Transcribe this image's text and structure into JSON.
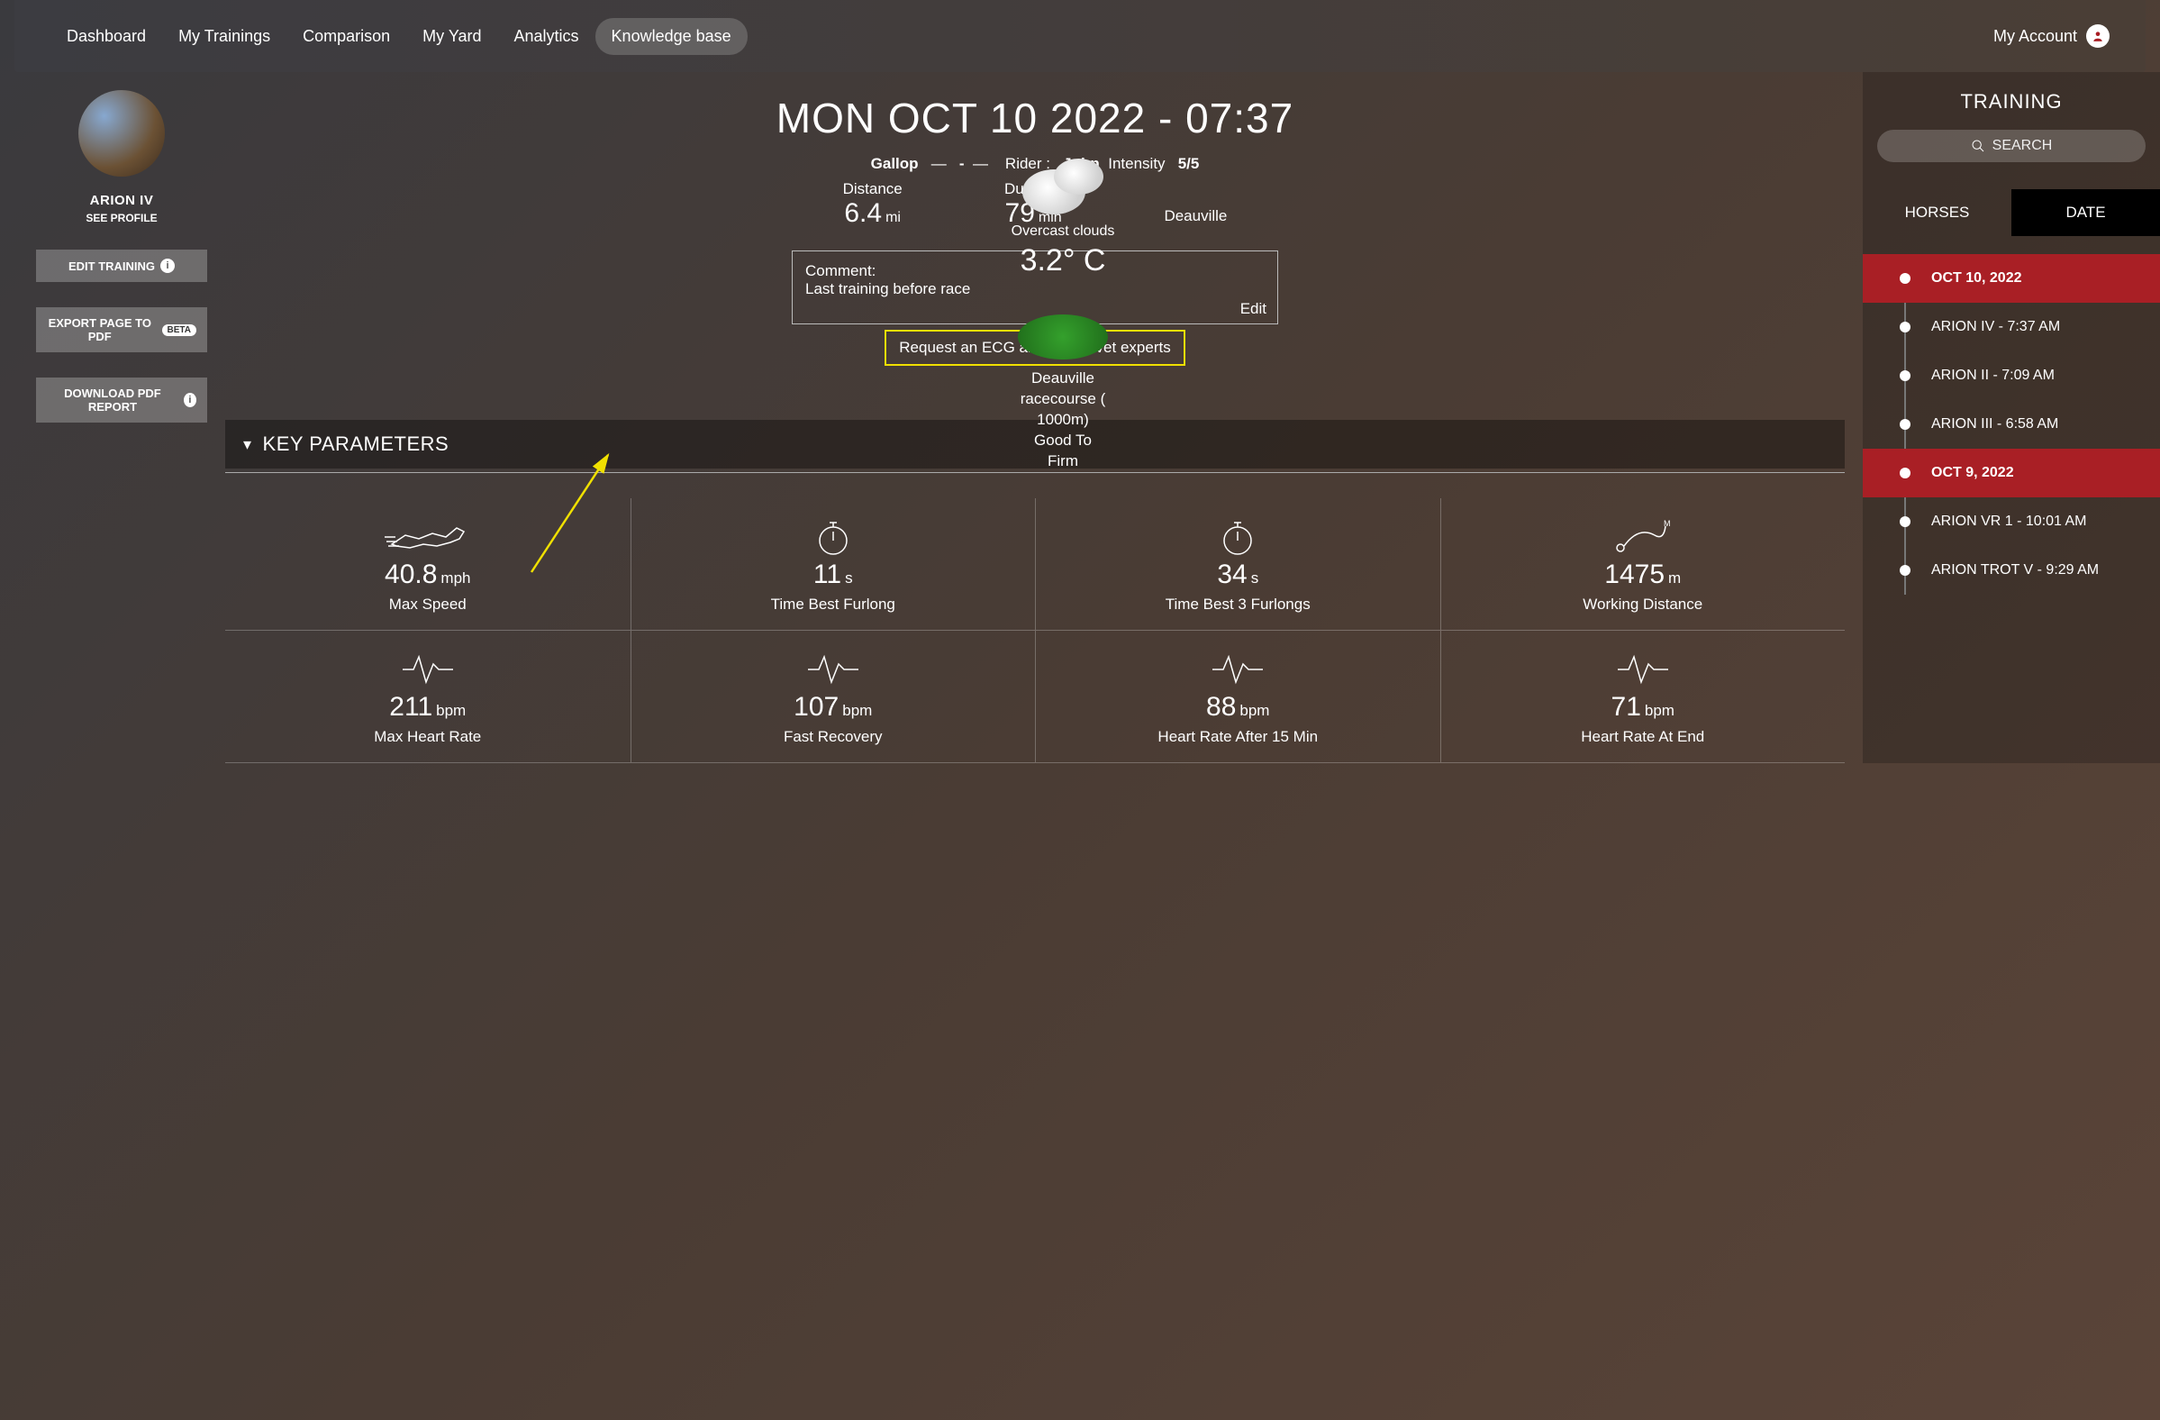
{
  "nav": {
    "items": [
      "Dashboard",
      "My Trainings",
      "Comparison",
      "My Yard",
      "Analytics",
      "Knowledge base"
    ],
    "active_index": 5,
    "account": "My Account"
  },
  "horse": {
    "name": "ARION IV",
    "see_profile": "SEE PROFILE"
  },
  "left_buttons": {
    "edit_training": "EDIT TRAINING",
    "export_pdf": "EXPORT PAGE TO PDF",
    "export_badge": "BETA",
    "download_pdf": "DOWNLOAD PDF REPORT"
  },
  "header": {
    "title": "MON OCT 10 2022 - 07:37",
    "gait": "Gallop",
    "sep1": "—",
    "dash": "-",
    "sep2": "—",
    "rider_label": "Rider :",
    "rider": "John",
    "intensity_label": "Intensity",
    "intensity": "5/5",
    "distance_label": "Distance",
    "distance_value": "6.4",
    "distance_unit": "mi",
    "duration_label": "Duration",
    "duration_value": "79",
    "duration_unit": "min",
    "location": "Deauville"
  },
  "comment": {
    "label": "Comment:",
    "text": "Last training before race",
    "edit": "Edit"
  },
  "ecg_button": "Request an ECG analysis to vet experts",
  "weather": {
    "desc": "Overcast clouds",
    "temp": "3.2° C",
    "course_line1": "Deauville",
    "course_line2": "racecourse (",
    "course_line3": "1000m)",
    "course_line4": "Good To",
    "course_line5": "Firm"
  },
  "key_params_title": "KEY PARAMETERS",
  "params": [
    {
      "icon": "horse",
      "value": "40.8",
      "unit": "mph",
      "label": "Max Speed"
    },
    {
      "icon": "stopwatch",
      "value": "11",
      "unit": "s",
      "label": "Time Best Furlong"
    },
    {
      "icon": "stopwatch",
      "value": "34",
      "unit": "s",
      "label": "Time Best 3 Furlongs"
    },
    {
      "icon": "path",
      "value": "1475",
      "unit": "m",
      "label": "Working Distance"
    },
    {
      "icon": "heart",
      "value": "211",
      "unit": "bpm",
      "label": "Max Heart Rate"
    },
    {
      "icon": "heart",
      "value": "107",
      "unit": "bpm",
      "label": "Fast Recovery"
    },
    {
      "icon": "heart",
      "value": "88",
      "unit": "bpm",
      "label": "Heart Rate After 15 Min"
    },
    {
      "icon": "heart",
      "value": "71",
      "unit": "bpm",
      "label": "Heart Rate At End"
    }
  ],
  "sidebar": {
    "title": "TRAINING",
    "search_placeholder": "SEARCH",
    "tabs": [
      "HORSES",
      "DATE"
    ],
    "active_tab": 1,
    "timeline": [
      {
        "type": "date",
        "label": "OCT 10, 2022"
      },
      {
        "type": "entry",
        "label": "ARION IV - 7:37 AM"
      },
      {
        "type": "entry",
        "label": "ARION II - 7:09 AM"
      },
      {
        "type": "entry",
        "label": "ARION III - 6:58 AM"
      },
      {
        "type": "date",
        "label": "OCT 9, 2022"
      },
      {
        "type": "entry",
        "label": "ARION VR 1 - 10:01 AM"
      },
      {
        "type": "entry",
        "label": "ARION TROT V - 9:29 AM"
      }
    ]
  }
}
